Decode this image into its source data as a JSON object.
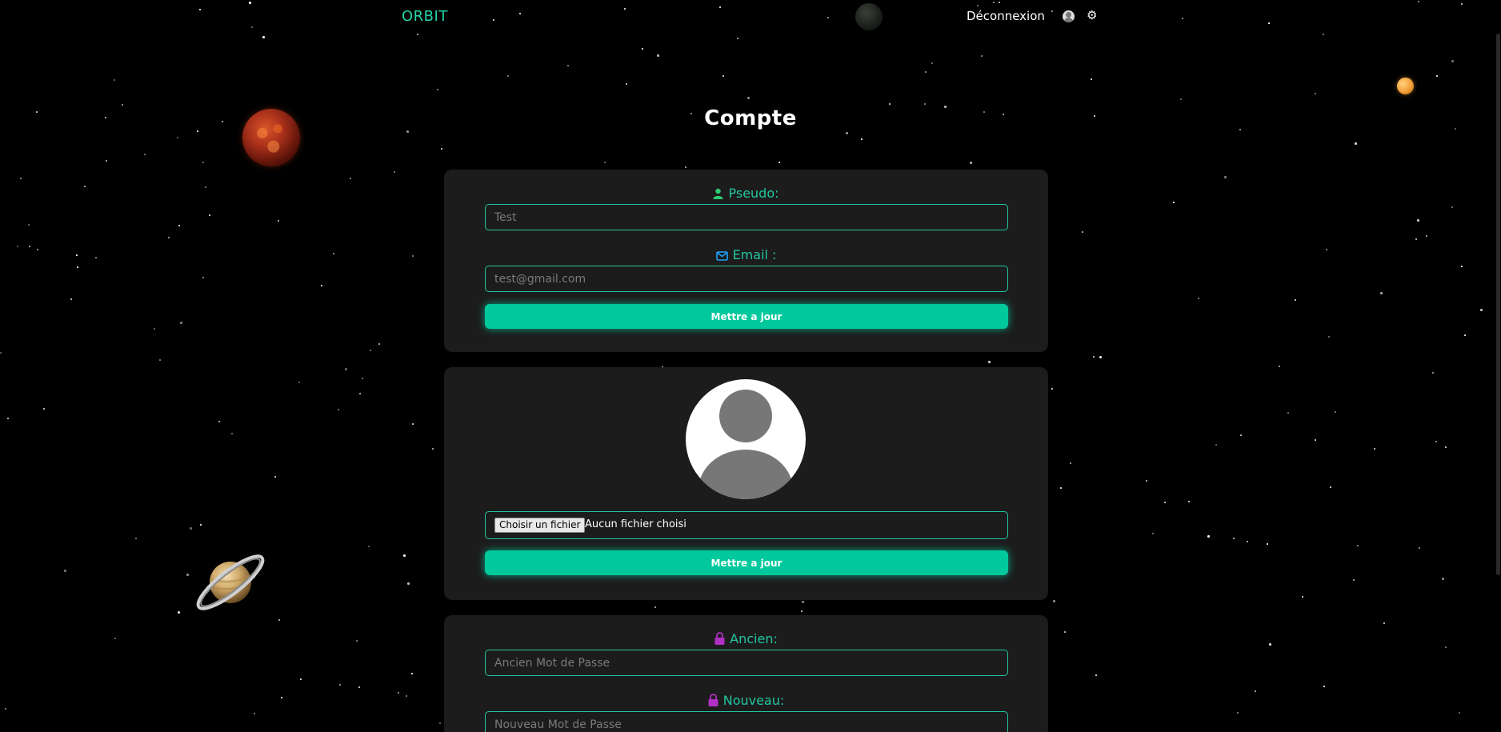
{
  "header": {
    "logo": "ORBIT",
    "logout_label": "Déconnexion"
  },
  "page": {
    "title": "Compte"
  },
  "profile_form": {
    "pseudo_label": "Pseudo:",
    "pseudo_placeholder": "Test",
    "email_label": "Email :",
    "email_placeholder": "test@gmail.com",
    "submit_label": "Mettre a jour"
  },
  "avatar_form": {
    "file_button_label": "Choisir un fichier",
    "file_status": "Aucun fichier choisi",
    "submit_label": "Mettre a jour"
  },
  "password_form": {
    "old_label": "Ancien:",
    "old_placeholder": "Ancien Mot de Passe",
    "new_label": "Nouveau:",
    "new_placeholder": "Nouveau Mot de Passe"
  },
  "icons": {
    "user": "user-icon",
    "email": "envelope-icon",
    "lock": "lock-icon",
    "settings": "gear-icon",
    "avatar": "avatar-icon"
  },
  "colors": {
    "accent": "#21c7a0",
    "button": "#02c89d",
    "card_bg": "#1c1c1c",
    "lock": "#b12fc4",
    "email_icon": "#1fa3ff",
    "user_icon": "#2ecc71"
  }
}
